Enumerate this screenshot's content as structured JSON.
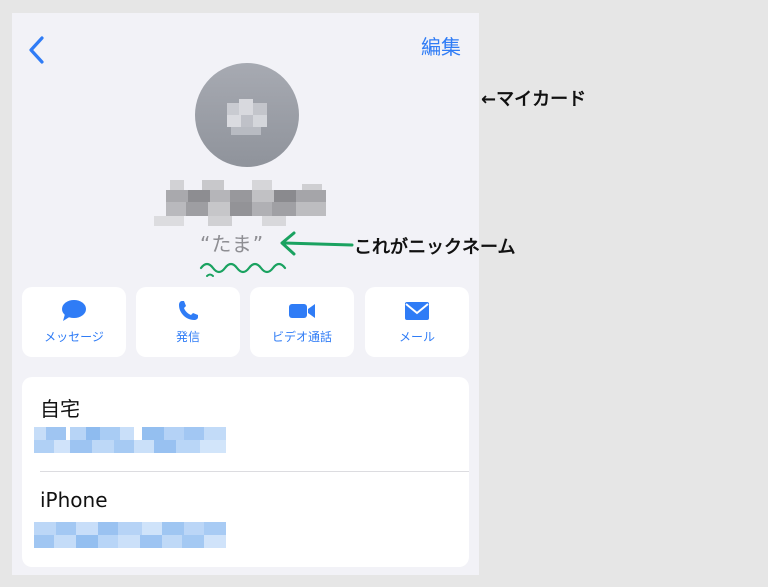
{
  "nav": {
    "edit_label": "編集"
  },
  "contact": {
    "nickname": "“たま”"
  },
  "annotations": {
    "my_card": "←マイカード",
    "nickname_note": "これがニックネーム"
  },
  "actions": [
    {
      "label": "メッセージ",
      "icon": "message-icon"
    },
    {
      "label": "発信",
      "icon": "phone-icon"
    },
    {
      "label": "ビデオ通話",
      "icon": "video-icon"
    },
    {
      "label": "メール",
      "icon": "mail-icon"
    }
  ],
  "fields": [
    {
      "label": "自宅"
    },
    {
      "label": "iPhone"
    }
  ],
  "colors": {
    "accent": "#2f7cf6",
    "annotation": "#1aa260",
    "background": "#f2f2f7"
  }
}
